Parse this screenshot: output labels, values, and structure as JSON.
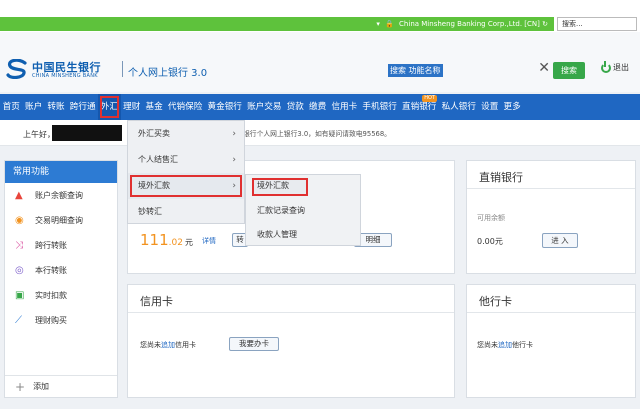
{
  "browser": {
    "address_text": "China Minsheng Banking Corp.,Ltd. [CN]",
    "search_placeholder": "搜索..."
  },
  "header": {
    "logo_cn": "中国民生银行",
    "logo_en": "CHINA MINSHENG BANK",
    "product_name": "个人网上银行 3.0",
    "search_value": "搜索 功能名称",
    "search_button": "搜索",
    "logout_label": "退出"
  },
  "nav": {
    "items": [
      {
        "label": "首页"
      },
      {
        "label": "账户"
      },
      {
        "label": "转账"
      },
      {
        "label": "跨行通"
      },
      {
        "label": "外汇",
        "active": true
      },
      {
        "label": "理财"
      },
      {
        "label": "基金"
      },
      {
        "label": "代销保险"
      },
      {
        "label": "黄金银行"
      },
      {
        "label": "账户交易"
      },
      {
        "label": "贷款"
      },
      {
        "label": "缴费"
      },
      {
        "label": "信用卡"
      },
      {
        "label": "手机银行"
      },
      {
        "label": "直销银行",
        "badge": "HOT"
      },
      {
        "label": "私人银行"
      },
      {
        "label": "设置"
      },
      {
        "label": "更多"
      }
    ]
  },
  "greeting": {
    "text": "上午好，",
    "notice": "银行个人网上银行3.0，如有疑问请致电95568。"
  },
  "sidebar": {
    "title": "常用功能",
    "items": [
      {
        "label": "账户余额查询",
        "icon": "account-balance-icon"
      },
      {
        "label": "交易明细查询",
        "icon": "transaction-search-icon"
      },
      {
        "label": "跨行转账",
        "icon": "cross-bank-transfer-icon"
      },
      {
        "label": "本行转账",
        "icon": "in-bank-transfer-icon"
      },
      {
        "label": "实时扣款",
        "icon": "realtime-debit-icon"
      },
      {
        "label": "理财购买",
        "icon": "wealth-chart-icon"
      }
    ],
    "add_label": "添加"
  },
  "dropdown": {
    "items": [
      {
        "label": "外汇买卖",
        "has_sub": true
      },
      {
        "label": "个人结售汇",
        "has_sub": true
      },
      {
        "label": "境外汇款",
        "has_sub": true,
        "highlighted": true
      },
      {
        "label": "钞转汇",
        "has_sub": false
      }
    ]
  },
  "submenu": {
    "items": [
      {
        "label": "境外汇款",
        "highlighted": true
      },
      {
        "label": "汇款记录查询"
      },
      {
        "label": "收款人管理"
      }
    ]
  },
  "panel_account": {
    "amount_int": "111",
    "amount_dec": ".02",
    "amount_unit": "元",
    "detail_link": "详情",
    "btn_partial": "转",
    "btn_detail": "明细"
  },
  "panel_direct": {
    "title": "直销银行",
    "balance_label": "可用余额",
    "balance_value": "0.00元",
    "deposit_button": "进 入"
  },
  "panel_credit": {
    "title": "信用卡",
    "text_prefix": "您尚未",
    "text_link": "追加",
    "text_suffix": "信用卡",
    "apply_button": "我要办卡"
  },
  "panel_other": {
    "title": "他行卡",
    "text_prefix": "您尚未",
    "text_link": "追加",
    "text_suffix": "他行卡"
  },
  "colors": {
    "brand_blue": "#1f67c2",
    "accent_green": "#37a749",
    "highlight_red": "#e03030",
    "amount_orange": "#f29320"
  }
}
